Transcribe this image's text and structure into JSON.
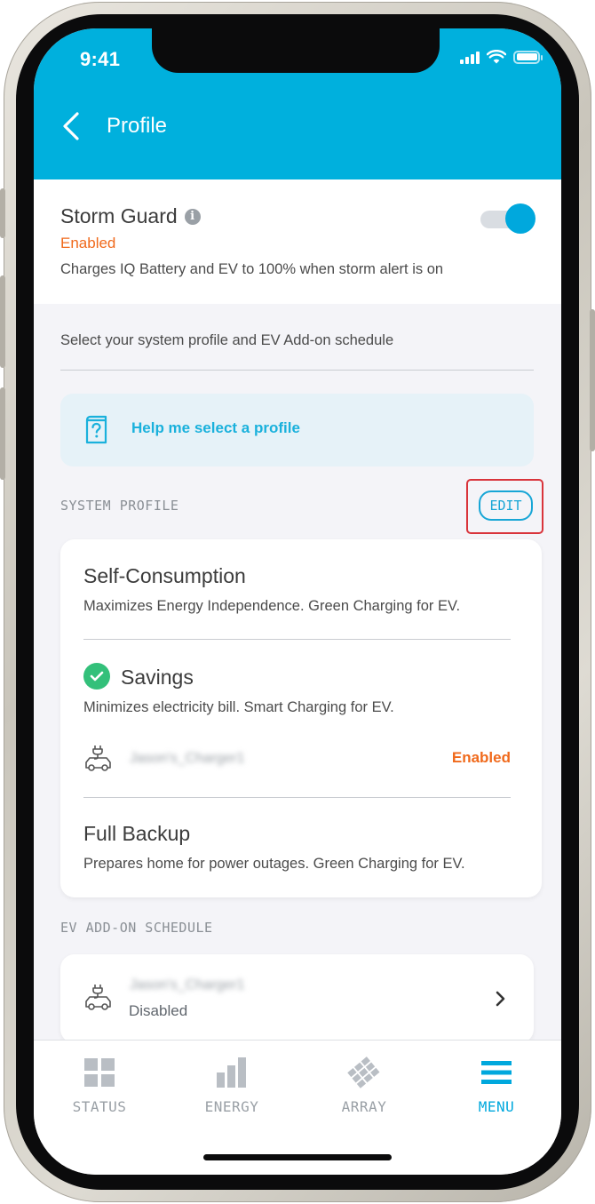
{
  "status_bar": {
    "time": "9:41"
  },
  "header": {
    "title": "Profile"
  },
  "storm_guard": {
    "title": "Storm Guard",
    "status": "Enabled",
    "description": "Charges IQ Battery and EV to 100% when storm alert is on",
    "toggle_on": true
  },
  "intro": {
    "text": "Select your system profile and EV Add-on schedule"
  },
  "help": {
    "label": "Help me select a profile"
  },
  "system_profile": {
    "section_label": "SYSTEM PROFILE",
    "edit_label": "EDIT",
    "options": [
      {
        "title": "Self-Consumption",
        "description": "Maximizes Energy Independence. Green Charging for EV.",
        "selected": false
      },
      {
        "title": "Savings",
        "description": "Minimizes electricity bill. Smart Charging for EV.",
        "selected": true,
        "charger_name": "Jason's_Charger1",
        "charger_status": "Enabled"
      },
      {
        "title": "Full Backup",
        "description": "Prepares home for power outages. Green Charging for EV.",
        "selected": false
      }
    ]
  },
  "ev_schedule": {
    "section_label": "EV ADD-ON SCHEDULE",
    "charger_name": "Jason's_Charger1",
    "status": "Disabled"
  },
  "bottom_nav": {
    "items": [
      {
        "label": "STATUS",
        "icon": "grid-icon",
        "active": false
      },
      {
        "label": "ENERGY",
        "icon": "bar-chart-icon",
        "active": false
      },
      {
        "label": "ARRAY",
        "icon": "solar-array-icon",
        "active": false
      },
      {
        "label": "MENU",
        "icon": "hamburger-menu-icon",
        "active": true
      }
    ]
  },
  "colors": {
    "brand": "#00b0dd",
    "accent_orange": "#f06a1c",
    "success_green": "#33c07a",
    "highlight_red": "#d9343b"
  }
}
